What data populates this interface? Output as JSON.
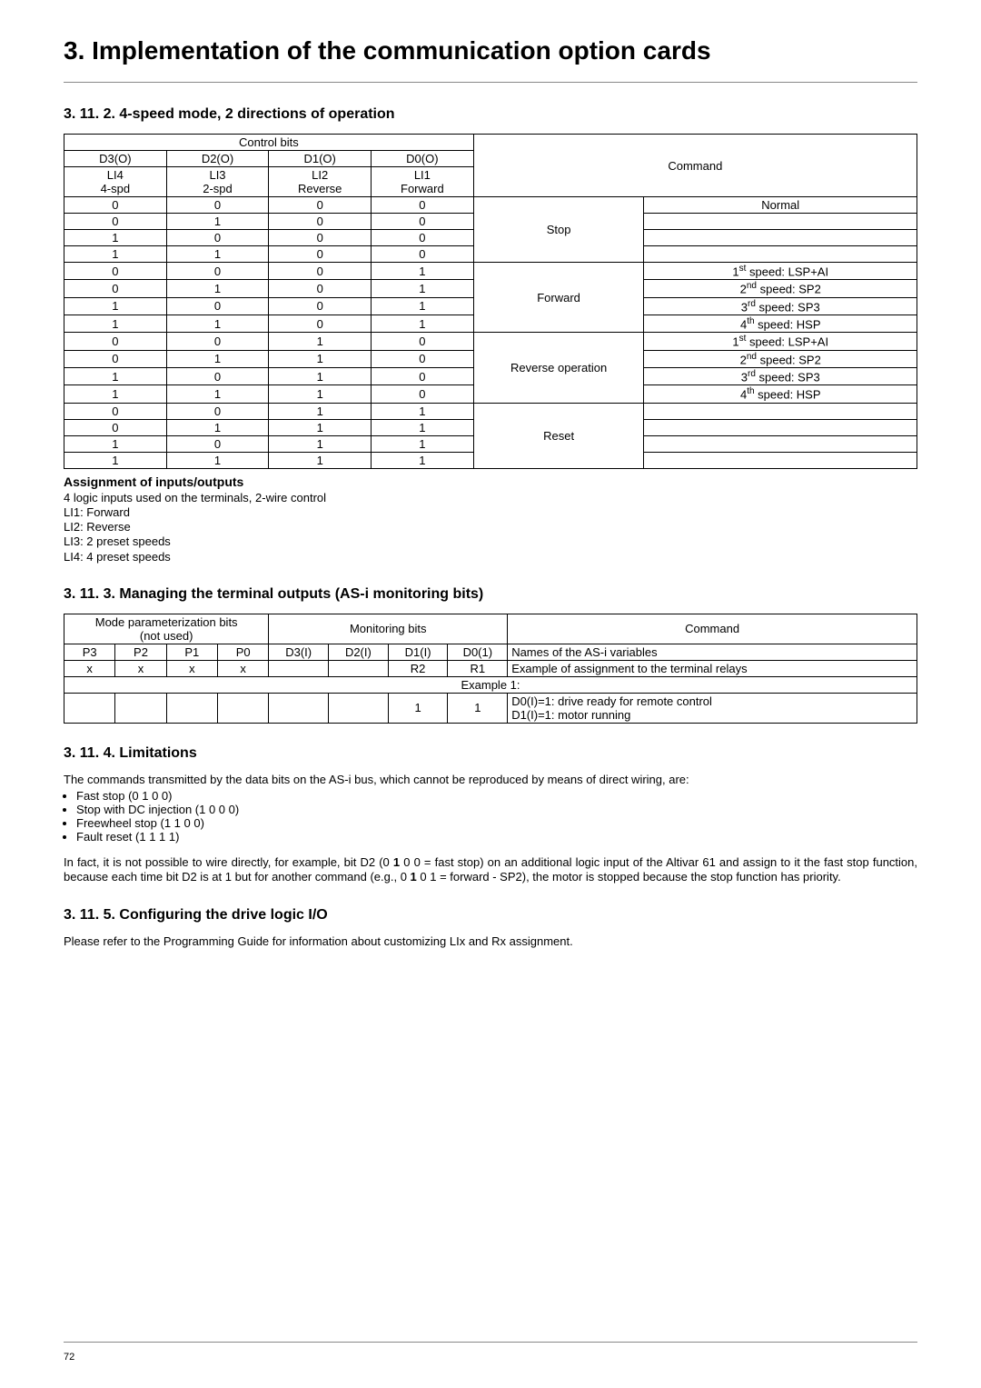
{
  "main_title": "3. Implementation of the communication option cards",
  "page_number": "72",
  "sec_3_11_2": {
    "title": "3. 11. 2. 4-speed mode, 2 directions of operation",
    "table": {
      "hdr_control_bits": "Control bits",
      "hdr_command": "Command",
      "hdr": {
        "d3o": "D3(O)",
        "d2o": "D2(O)",
        "d1o": "D1(O)",
        "d0o": "D0(O)",
        "li4": "LI4",
        "li3": "LI3",
        "li2": "LI2",
        "li1": "LI1",
        "fourspd": "4-spd",
        "twospd": "2-spd",
        "reverse": "Reverse",
        "forward": "Forward"
      },
      "groups": [
        {
          "label": "Stop",
          "rows": [
            {
              "d3": "0",
              "d2": "0",
              "d1": "0",
              "d0": "0",
              "detail": "Normal"
            },
            {
              "d3": "0",
              "d2": "1",
              "d1": "0",
              "d0": "0",
              "detail": ""
            },
            {
              "d3": "1",
              "d2": "0",
              "d1": "0",
              "d0": "0",
              "detail": ""
            },
            {
              "d3": "1",
              "d2": "1",
              "d1": "0",
              "d0": "0",
              "detail": ""
            }
          ]
        },
        {
          "label": "Forward",
          "rows": [
            {
              "d3": "0",
              "d2": "0",
              "d1": "0",
              "d0": "1",
              "sup": "st",
              "supn": "1",
              "detail": " speed: LSP+AI"
            },
            {
              "d3": "0",
              "d2": "1",
              "d1": "0",
              "d0": "1",
              "sup": "nd",
              "supn": "2",
              "detail": " speed: SP2"
            },
            {
              "d3": "1",
              "d2": "0",
              "d1": "0",
              "d0": "1",
              "sup": "rd",
              "supn": "3",
              "detail": " speed: SP3"
            },
            {
              "d3": "1",
              "d2": "1",
              "d1": "0",
              "d0": "1",
              "sup": "th",
              "supn": "4",
              "detail": " speed: HSP"
            }
          ]
        },
        {
          "label": "Reverse operation",
          "rows": [
            {
              "d3": "0",
              "d2": "0",
              "d1": "1",
              "d0": "0",
              "sup": "st",
              "supn": "1",
              "detail": " speed: LSP+AI"
            },
            {
              "d3": "0",
              "d2": "1",
              "d1": "1",
              "d0": "0",
              "sup": "nd",
              "supn": "2",
              "detail": " speed: SP2"
            },
            {
              "d3": "1",
              "d2": "0",
              "d1": "1",
              "d0": "0",
              "sup": "rd",
              "supn": "3",
              "detail": " speed: SP3"
            },
            {
              "d3": "1",
              "d2": "1",
              "d1": "1",
              "d0": "0",
              "sup": "th",
              "supn": "4",
              "detail": " speed: HSP"
            }
          ]
        },
        {
          "label": "Reset",
          "rows": [
            {
              "d3": "0",
              "d2": "0",
              "d1": "1",
              "d0": "1",
              "detail": ""
            },
            {
              "d3": "0",
              "d2": "1",
              "d1": "1",
              "d0": "1",
              "detail": ""
            },
            {
              "d3": "1",
              "d2": "0",
              "d1": "1",
              "d0": "1",
              "detail": ""
            },
            {
              "d3": "1",
              "d2": "1",
              "d1": "1",
              "d0": "1",
              "detail": ""
            }
          ]
        }
      ]
    },
    "assign_title": "Assignment of inputs/outputs",
    "assign_lines": [
      "4 logic inputs used on the terminals, 2-wire control",
      "LI1: Forward",
      "LI2: Reverse",
      "LI3: 2 preset speeds",
      "LI4: 4 preset speeds"
    ]
  },
  "sec_3_11_3": {
    "title": "3. 11. 3. Managing the terminal outputs (AS-i monitoring bits)",
    "table": {
      "hdr_mode": "Mode parameterization bits\n(not used)",
      "hdr_monitor": "Monitoring bits",
      "hdr_command": "Command",
      "p3": "P3",
      "p2": "P2",
      "p1": "P1",
      "p0": "P0",
      "d3i": "D3(I)",
      "d2i": "D2(I)",
      "d1i": "D1(I)",
      "d0i": "D0(1)",
      "x": "x",
      "r2": "R2",
      "r1": "R1",
      "names": "Names of the AS-i variables",
      "example_assign": "Example of assignment to the terminal relays",
      "example1": "Example 1:",
      "v1": "1",
      "v1b": "1",
      "example_detail": "D0(I)=1: drive ready for remote control\nD1(I)=1: motor running"
    }
  },
  "sec_3_11_4": {
    "title": "3. 11. 4. Limitations",
    "intro": "The commands transmitted by the data bits on the AS-i bus, which cannot be reproduced by means of direct wiring, are:",
    "bullets": [
      "Fast stop (0 1 0 0)",
      "Stop with DC injection (1 0 0 0)",
      "Freewheel stop (1 1 0 0)",
      "Fault reset (1 1 1 1)"
    ],
    "para_parts": {
      "p1": "In fact, it is not possible to wire directly, for example, bit D2 (0 ",
      "b1": "1",
      "p2": " 0 0 = fast stop) on an additional logic input of the Altivar 61 and assign to it the fast stop function, because each time bit D2 is at 1 but for another command (e.g., 0 ",
      "b2": "1",
      "p3": " 0 1 = forward - SP2), the motor is stopped because the stop function has priority."
    }
  },
  "sec_3_11_5": {
    "title": "3. 11. 5. Configuring the drive logic I/O",
    "para": "Please refer to the Programming Guide for information about customizing LIx and Rx assignment."
  }
}
